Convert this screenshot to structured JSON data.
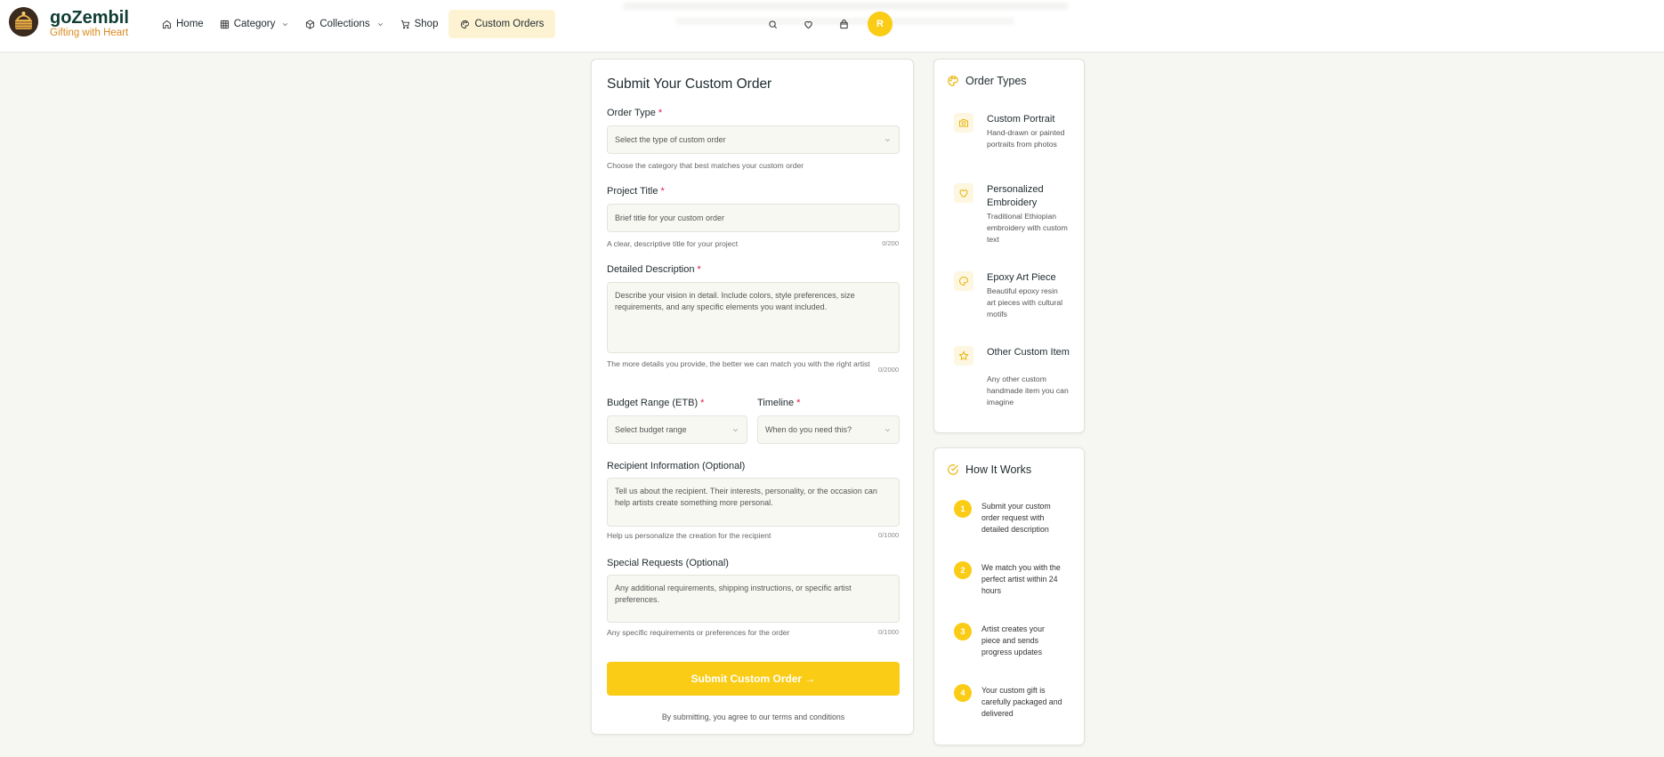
{
  "brand": {
    "name": "goZembil",
    "tagline": "Gifting with Heart"
  },
  "nav": {
    "home": "Home",
    "category": "Category",
    "collections": "Collections",
    "shop": "Shop",
    "custom_orders": "Custom Orders"
  },
  "header": {
    "avatar_initial": "R"
  },
  "colors": {
    "accent": "#facc15",
    "brand": "#0f3d33",
    "tagline": "#d98a1e",
    "required": "#e11d48"
  },
  "form": {
    "title": "Submit Your Custom Order",
    "order_type": {
      "label": "Order Type",
      "required": "*",
      "placeholder": "Select the type of custom order",
      "help": "Choose the category that best matches your custom order"
    },
    "project_title": {
      "label": "Project Title",
      "required": "*",
      "placeholder": "Brief title for your custom order",
      "help": "A clear, descriptive title for your project",
      "count": "0/200"
    },
    "description": {
      "label": "Detailed Description",
      "required": "*",
      "placeholder": "Describe your vision in detail. Include colors, style preferences, size requirements, and any specific elements you want included.",
      "help": "The more details you provide, the better we can match you with the right artist",
      "count": "0/2000"
    },
    "budget": {
      "label": "Budget Range (ETB)",
      "required": "*",
      "placeholder": "Select budget range"
    },
    "timeline": {
      "label": "Timeline",
      "required": "*",
      "placeholder": "When do you need this?"
    },
    "recipient": {
      "label": "Recipient Information (Optional)",
      "placeholder": "Tell us about the recipient. Their interests, personality, or the occasion can help artists create something more personal.",
      "help": "Help us personalize the creation for the recipient",
      "count": "0/1000"
    },
    "special": {
      "label": "Special Requests (Optional)",
      "placeholder": "Any additional requirements, shipping instructions, or specific artist preferences.",
      "help": "Any specific requirements or preferences for the order",
      "count": "0/1000"
    },
    "submit_label": "Submit Custom Order →",
    "terms": "By submitting, you agree to our terms and conditions"
  },
  "order_types": {
    "title": "Order Types",
    "items": [
      {
        "name": "Custom Portrait",
        "desc": "Hand-drawn or painted portraits from photos",
        "icon": "camera-icon"
      },
      {
        "name": "Personalized Embroidery",
        "desc": "Traditional Ethiopian embroidery with custom text",
        "icon": "heart-icon"
      },
      {
        "name": "Epoxy Art Piece",
        "desc": "Beautiful epoxy resin art pieces with cultural motifs",
        "icon": "palette-icon"
      },
      {
        "name": "Other Custom Item",
        "desc": "Any other custom handmade item you can imagine",
        "icon": "star-icon"
      }
    ]
  },
  "how_it_works": {
    "title": "How It Works",
    "steps": [
      {
        "num": "1",
        "text": "Submit your custom order request with detailed description"
      },
      {
        "num": "2",
        "text": "We match you with the perfect artist within 24 hours"
      },
      {
        "num": "3",
        "text": "Artist creates your piece and sends progress updates"
      },
      {
        "num": "4",
        "text": "Your custom gift is carefully packaged and delivered"
      }
    ]
  }
}
